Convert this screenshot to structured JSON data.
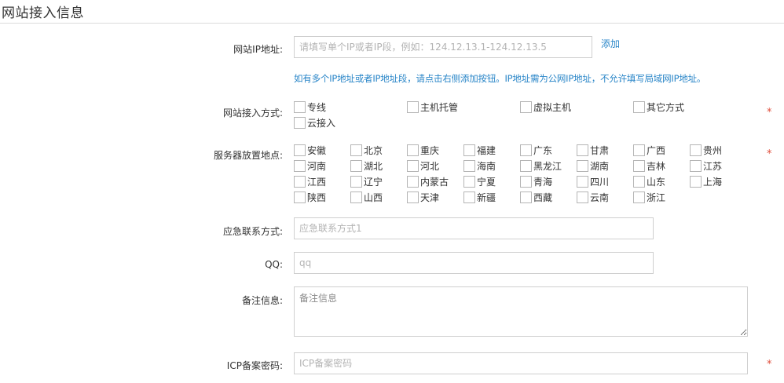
{
  "page": {
    "title": "网站接入信息"
  },
  "ip": {
    "label": "网站IP地址:",
    "placeholder": "请填写单个IP或者IP段，例如：124.12.13.1-124.12.13.5",
    "add_label": "添加",
    "hint": "如有多个IP地址或者IP地址段，请点击右侧添加按钮。IP地址需为公网IP地址，不允许填写局域网IP地址。"
  },
  "access": {
    "label": "网站接入方式:",
    "options": [
      "专线",
      "主机托管",
      "虚拟主机",
      "其它方式",
      "云接入"
    ],
    "required_mark": "*"
  },
  "location": {
    "label": "服务器放置地点:",
    "options": [
      "安徽",
      "北京",
      "重庆",
      "福建",
      "广东",
      "甘肃",
      "广西",
      "贵州",
      "河南",
      "湖北",
      "河北",
      "海南",
      "黑龙江",
      "湖南",
      "吉林",
      "江苏",
      "江西",
      "辽宁",
      "内蒙古",
      "宁夏",
      "青海",
      "四川",
      "山东",
      "上海",
      "陕西",
      "山西",
      "天津",
      "新疆",
      "西藏",
      "云南",
      "浙江"
    ],
    "required_mark": "*"
  },
  "emergency": {
    "label": "应急联系方式:",
    "placeholder": "应急联系方式1"
  },
  "qq": {
    "label": "QQ:",
    "placeholder": "qq"
  },
  "remark": {
    "label": "备注信息:",
    "placeholder": "备注信息"
  },
  "icp": {
    "label": "ICP备案密码:",
    "placeholder": "ICP备案密码",
    "required_mark": "*"
  }
}
